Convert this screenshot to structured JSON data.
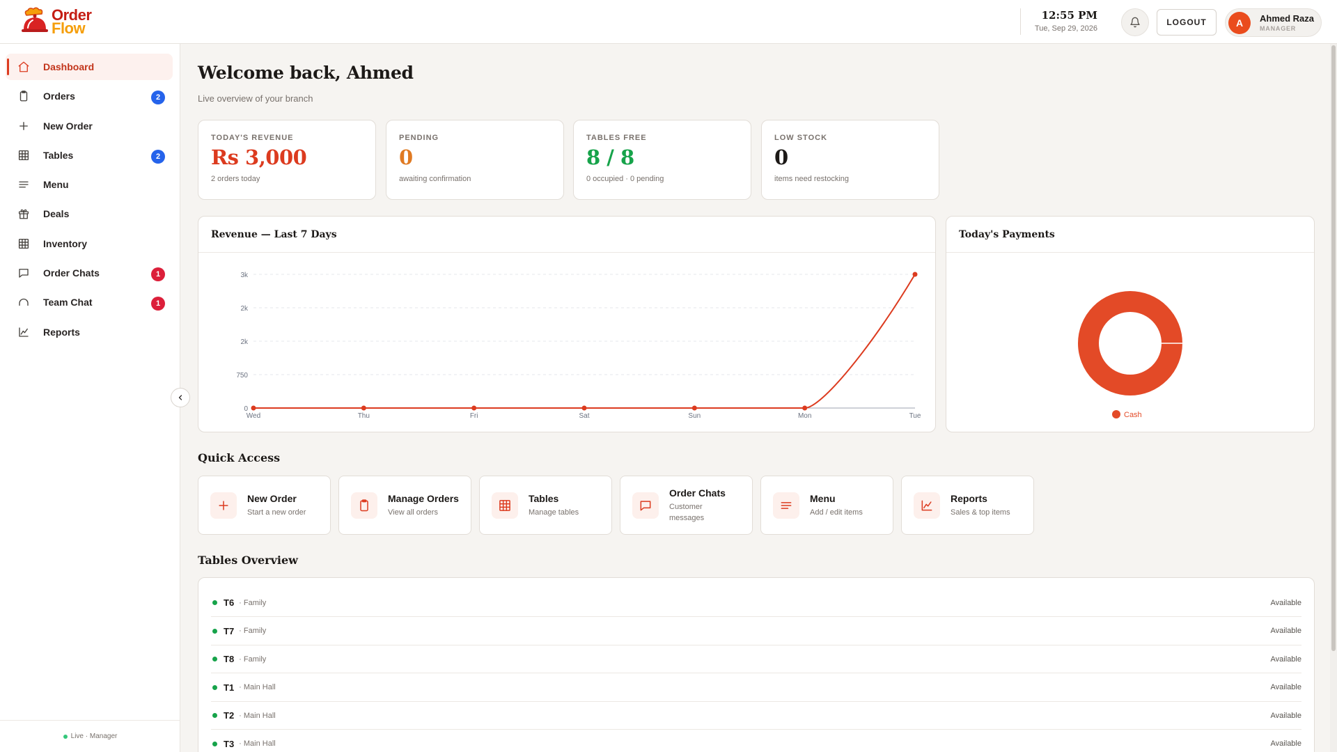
{
  "app": {
    "logo_line1": "Order",
    "logo_line2": "Flow"
  },
  "header": {
    "time": "12:55 PM",
    "date": "Tue, Sep 29, 2026",
    "logout_label": "LOGOUT",
    "user": {
      "initial": "A",
      "name": "Ahmed Raza",
      "role": "MANAGER"
    }
  },
  "sidebar": {
    "items": [
      {
        "label": "Dashboard",
        "icon": "home-icon",
        "active": true,
        "badge": ""
      },
      {
        "label": "Orders",
        "icon": "clipboard-icon",
        "badge": "2",
        "badge_color": "#2563eb"
      },
      {
        "label": "New Order",
        "icon": "plus-icon",
        "badge": ""
      },
      {
        "label": "Tables",
        "icon": "grid-icon",
        "badge": "2",
        "badge_color": "#2563eb"
      },
      {
        "label": "Menu",
        "icon": "menu-lines-icon",
        "badge": ""
      },
      {
        "label": "Deals",
        "icon": "gift-icon",
        "badge": ""
      },
      {
        "label": "Inventory",
        "icon": "grid-icon",
        "badge": ""
      },
      {
        "label": "Order Chats",
        "icon": "chat-icon",
        "badge": "1",
        "badge_color": "#dc1f3a"
      },
      {
        "label": "Team Chat",
        "icon": "headset-icon",
        "badge": "1",
        "badge_color": "#dc1f3a"
      },
      {
        "label": "Reports",
        "icon": "chart-line-icon",
        "badge": ""
      }
    ],
    "footer": "Live · Manager"
  },
  "main": {
    "title": "Welcome back, Ahmed",
    "subtitle": "Live overview of your branch",
    "stats": [
      {
        "key": "TODAY'S REVENUE",
        "value": "Rs 3,000",
        "sub": "2 orders today",
        "color": "#dc3b1f"
      },
      {
        "key": "PENDING",
        "value": "0",
        "sub": "awaiting confirmation",
        "color": "#e07a22"
      },
      {
        "key": "TABLES FREE",
        "value": "8 / 8",
        "sub": "0 occupied · 0 pending",
        "color": "#16a34a"
      },
      {
        "key": "LOW STOCK",
        "value": "0",
        "sub": "items need restocking",
        "color": "#1c1917"
      }
    ],
    "revenue_card_title": "Revenue — Last 7 Days",
    "payments_card_title": "Today's Payments",
    "quick_access_title": "Quick Access",
    "quick_access": [
      {
        "name": "New Order",
        "desc": "Start a new order",
        "icon": "plus-icon"
      },
      {
        "name": "Manage Orders",
        "desc": "View all orders",
        "icon": "clipboard-icon"
      },
      {
        "name": "Tables",
        "desc": "Manage tables",
        "icon": "grid-icon"
      },
      {
        "name": "Order Chats",
        "desc": "Customer messages",
        "icon": "chat-icon"
      },
      {
        "name": "Menu",
        "desc": "Add / edit items",
        "icon": "menu-lines-icon"
      },
      {
        "name": "Reports",
        "desc": "Sales & top items",
        "icon": "chart-line-icon"
      }
    ],
    "tables_overview_title": "Tables Overview",
    "tables": [
      {
        "id": "T6",
        "area": "· Family",
        "status": "Available"
      },
      {
        "id": "T7",
        "area": "· Family",
        "status": "Available"
      },
      {
        "id": "T8",
        "area": "· Family",
        "status": "Available"
      },
      {
        "id": "T1",
        "area": "· Main Hall",
        "status": "Available"
      },
      {
        "id": "T2",
        "area": "· Main Hall",
        "status": "Available"
      },
      {
        "id": "T3",
        "area": "· Main Hall",
        "status": "Available"
      }
    ]
  },
  "chart_data": [
    {
      "type": "line",
      "x": [
        "Wed",
        "Thu",
        "Fri",
        "Sat",
        "Sun",
        "Mon",
        "Tue"
      ],
      "series": [
        {
          "values": [
            0,
            0,
            0,
            0,
            0,
            0,
            3000
          ],
          "color": "#dc3b1f"
        }
      ],
      "ylim": [
        0,
        3000
      ],
      "y_ticks": [
        0,
        750,
        1500,
        2250,
        3000
      ],
      "y_tick_labels": [
        "0",
        "750",
        "2k",
        "2k",
        "3k"
      ],
      "grid": true,
      "curve": "smooth"
    },
    {
      "type": "pie",
      "style": "donut",
      "slices": [
        {
          "label": "Cash",
          "value": 3000,
          "color": "#e34a27"
        }
      ],
      "legend": "bottom"
    }
  ]
}
